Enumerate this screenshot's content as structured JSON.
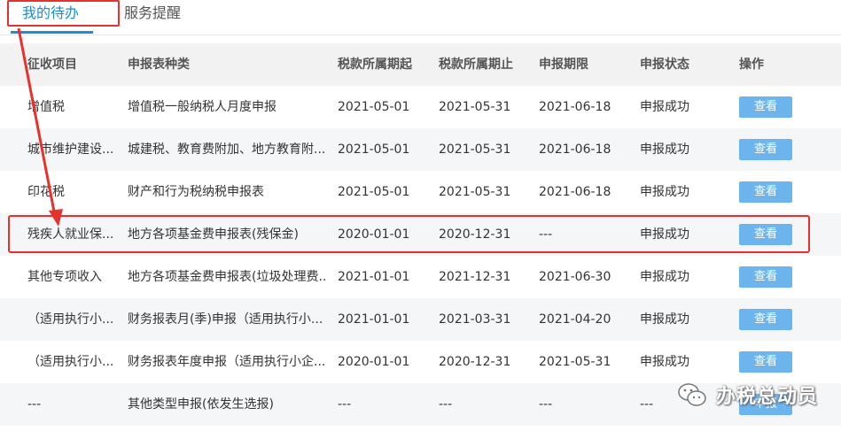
{
  "tabs": [
    {
      "label": "我的待办",
      "active": true
    },
    {
      "label": "服务提醒",
      "active": false
    }
  ],
  "table": {
    "headers": [
      "征收项目",
      "申报表种类",
      "税款所属期起",
      "税款所属期止",
      "申报期限",
      "申报状态",
      "操作"
    ],
    "rows": [
      {
        "project": "增值税",
        "form": "增值税一般纳税人月度申报",
        "start": "2021-05-01",
        "end": "2021-05-31",
        "deadline": "2021-06-18",
        "status": "申报成功",
        "action": "查看"
      },
      {
        "project": "城市维护建设...",
        "form": "城建税、教育费附加、地方教育附...",
        "start": "2021-05-01",
        "end": "2021-05-31",
        "deadline": "2021-06-18",
        "status": "申报成功",
        "action": "查看"
      },
      {
        "project": "印花税",
        "form": "财产和行为税纳税申报表",
        "start": "2021-05-01",
        "end": "2021-05-31",
        "deadline": "2021-06-18",
        "status": "申报成功",
        "action": "查看"
      },
      {
        "project": "残疾人就业保...",
        "form": "地方各项基金费申报表(残保金)",
        "start": "2020-01-01",
        "end": "2020-12-31",
        "deadline": "---",
        "status": "申报成功",
        "action": "查看"
      },
      {
        "project": "其他专项收入",
        "form": "地方各项基金费申报表(垃圾处理费...",
        "start": "2021-01-01",
        "end": "2021-12-31",
        "deadline": "2021-06-30",
        "status": "申报成功",
        "action": "查看"
      },
      {
        "project": "（适用执行小...",
        "form": "财务报表月(季)申报（适用执行小...",
        "start": "2021-01-01",
        "end": "2021-03-31",
        "deadline": "2021-04-20",
        "status": "申报成功",
        "action": "查看"
      },
      {
        "project": "（适用执行小...",
        "form": "财务报表年度申报（适用执行小企...",
        "start": "2020-01-01",
        "end": "2020-12-31",
        "deadline": "2021-05-31",
        "status": "申报成功",
        "action": "查看"
      },
      {
        "project": "---",
        "form": "其他类型申报(依发生选报)",
        "start": "---",
        "end": "---",
        "deadline": "---",
        "status": "---",
        "action": "申报"
      }
    ]
  },
  "watermark": {
    "text": "办税总动员",
    "icon": "wechat-icon"
  },
  "annotation": {
    "color": "#e5322d"
  }
}
